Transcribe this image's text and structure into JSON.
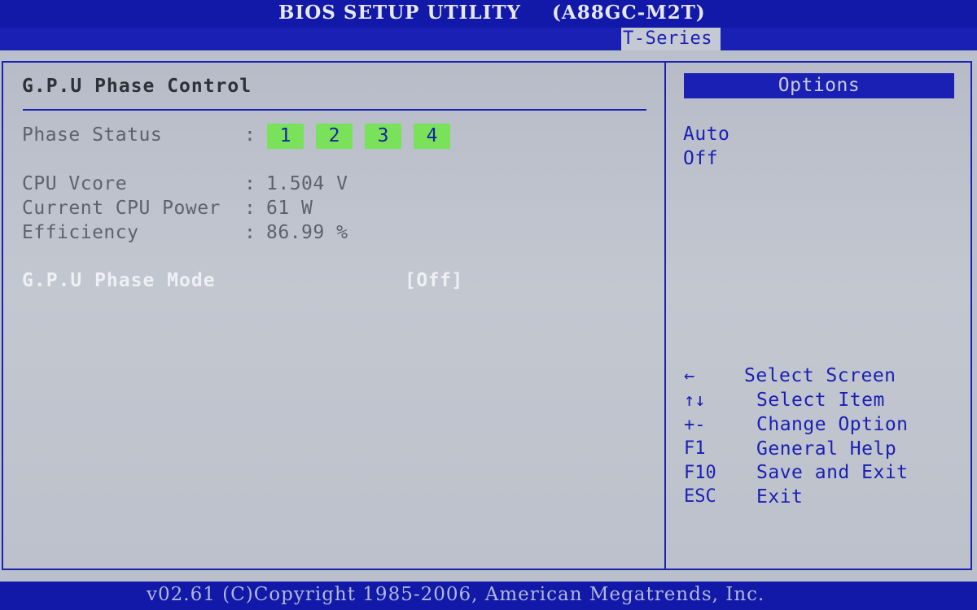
{
  "header": {
    "title": "BIOS SETUP UTILITY",
    "model": "(A88GC-M2T)",
    "active_tab": "T-Series"
  },
  "panel": {
    "title": "G.P.U Phase Control",
    "phase_status": {
      "label": "Phase Status",
      "separator": ":",
      "phases": [
        "1",
        "2",
        "3",
        "4"
      ]
    },
    "readings": [
      {
        "label": "CPU Vcore",
        "separator": ":",
        "value": "1.504 V"
      },
      {
        "label": "Current CPU Power",
        "separator": ":",
        "value": "61 W"
      },
      {
        "label": "Efficiency",
        "separator": ":",
        "value": "86.99 %"
      }
    ],
    "phase_mode": {
      "label": "G.P.U Phase Mode",
      "value": "[Off]"
    }
  },
  "options": {
    "header": "Options",
    "items": [
      "Auto",
      "Off"
    ]
  },
  "help": [
    {
      "key": "←",
      "desc": "Select Screen"
    },
    {
      "key": "↑↓",
      "desc": "Select Item"
    },
    {
      "key": "+-",
      "desc": "Change Option"
    },
    {
      "key": "F1",
      "desc": "General Help"
    },
    {
      "key": "F10",
      "desc": "Save and Exit"
    },
    {
      "key": "ESC",
      "desc": "Exit"
    }
  ],
  "footer": {
    "text": "v02.61 (C)Copyright 1985-2006, American Megatrends, Inc."
  },
  "colors": {
    "bios_blue": "#1a20b4",
    "panel_gray": "#bcc1cb",
    "phase_green": "#7ae25a",
    "highlight_text": "#eef0f4",
    "dim_text": "#5d626c"
  }
}
